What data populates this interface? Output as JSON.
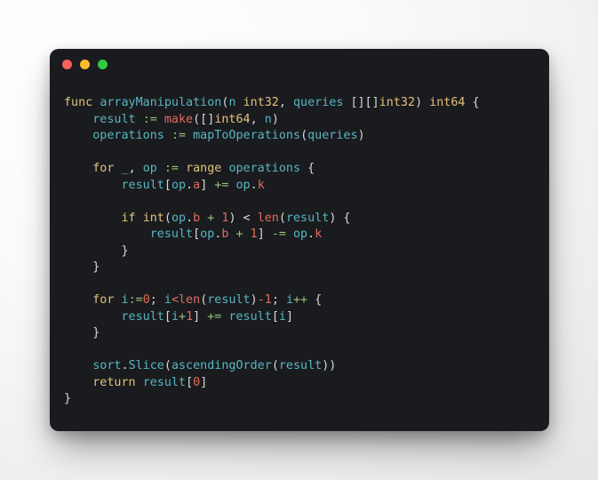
{
  "window": {
    "title": "",
    "traffic_lights": [
      {
        "name": "close",
        "color": "#f9615b"
      },
      {
        "name": "minimize",
        "color": "#fbbd2e"
      },
      {
        "name": "maximize",
        "color": "#2ecc41"
      }
    ]
  },
  "editor": {
    "language": "go",
    "background": "#1a1b1e",
    "foreground": "#d6d8da",
    "palette": {
      "keyword": "#e0c479",
      "type": "#e5c07b",
      "variable": "#56b6c2",
      "builtin": "#e06c5f",
      "number": "#e06c5f",
      "field": "#e06c5f",
      "operator": "#98c379",
      "punctuation": "#d6d8da"
    },
    "code_plain": "func arrayManipulation(n int32, queries [][]int32) int64 {\n    result := make([]int64, n)\n    operations := mapToOperations(queries)\n\n    for _, op := range operations {\n        result[op.a] += op.k\n\n        if int(op.b + 1) < len(result) {\n            result[op.b + 1] -= op.k\n        }\n    }\n\n    for i:=0; i<len(result)-1; i++ {\n        result[i+1] += result[i]\n    }\n\n    sort.Slice(ascendingOrder(result))\n    return result[0]\n}",
    "lines": [
      {
        "n": 1,
        "tokens": [
          {
            "t": "func",
            "c": "kw"
          },
          {
            "t": " ",
            "c": "pun"
          },
          {
            "t": "arrayManipulation",
            "c": "fn"
          },
          {
            "t": "(",
            "c": "pun"
          },
          {
            "t": "n",
            "c": "var"
          },
          {
            "t": " ",
            "c": "pun"
          },
          {
            "t": "int32",
            "c": "typ"
          },
          {
            "t": ", ",
            "c": "pun"
          },
          {
            "t": "queries",
            "c": "var"
          },
          {
            "t": " ",
            "c": "pun"
          },
          {
            "t": "[][]",
            "c": "pun"
          },
          {
            "t": "int32",
            "c": "typ"
          },
          {
            "t": ") ",
            "c": "pun"
          },
          {
            "t": "int64",
            "c": "typ"
          },
          {
            "t": " {",
            "c": "pun"
          }
        ]
      },
      {
        "n": 2,
        "tokens": [
          {
            "t": "    ",
            "c": "pun"
          },
          {
            "t": "result",
            "c": "var"
          },
          {
            "t": " ",
            "c": "pun"
          },
          {
            "t": ":=",
            "c": "op"
          },
          {
            "t": " ",
            "c": "pun"
          },
          {
            "t": "make",
            "c": "bi"
          },
          {
            "t": "([]",
            "c": "pun"
          },
          {
            "t": "int64",
            "c": "typ"
          },
          {
            "t": ", ",
            "c": "pun"
          },
          {
            "t": "n",
            "c": "var"
          },
          {
            "t": ")",
            "c": "pun"
          }
        ]
      },
      {
        "n": 3,
        "tokens": [
          {
            "t": "    ",
            "c": "pun"
          },
          {
            "t": "operations",
            "c": "var"
          },
          {
            "t": " ",
            "c": "pun"
          },
          {
            "t": ":=",
            "c": "op"
          },
          {
            "t": " ",
            "c": "pun"
          },
          {
            "t": "mapToOperations",
            "c": "fn"
          },
          {
            "t": "(",
            "c": "pun"
          },
          {
            "t": "queries",
            "c": "var"
          },
          {
            "t": ")",
            "c": "pun"
          }
        ]
      },
      {
        "n": 4,
        "tokens": []
      },
      {
        "n": 5,
        "tokens": [
          {
            "t": "    ",
            "c": "pun"
          },
          {
            "t": "for",
            "c": "kw"
          },
          {
            "t": " ",
            "c": "pun"
          },
          {
            "t": "_",
            "c": "var"
          },
          {
            "t": ", ",
            "c": "pun"
          },
          {
            "t": "op",
            "c": "var"
          },
          {
            "t": " ",
            "c": "pun"
          },
          {
            "t": ":=",
            "c": "op"
          },
          {
            "t": " ",
            "c": "pun"
          },
          {
            "t": "range",
            "c": "kw"
          },
          {
            "t": " ",
            "c": "pun"
          },
          {
            "t": "operations",
            "c": "var"
          },
          {
            "t": " {",
            "c": "pun"
          }
        ]
      },
      {
        "n": 6,
        "tokens": [
          {
            "t": "        ",
            "c": "pun"
          },
          {
            "t": "result",
            "c": "var"
          },
          {
            "t": "[",
            "c": "pun"
          },
          {
            "t": "op",
            "c": "var"
          },
          {
            "t": ".",
            "c": "pun"
          },
          {
            "t": "a",
            "c": "fld"
          },
          {
            "t": "] ",
            "c": "pun"
          },
          {
            "t": "+=",
            "c": "op"
          },
          {
            "t": " ",
            "c": "pun"
          },
          {
            "t": "op",
            "c": "var"
          },
          {
            "t": ".",
            "c": "pun"
          },
          {
            "t": "k",
            "c": "fld"
          }
        ]
      },
      {
        "n": 7,
        "tokens": []
      },
      {
        "n": 8,
        "tokens": [
          {
            "t": "        ",
            "c": "pun"
          },
          {
            "t": "if",
            "c": "kw"
          },
          {
            "t": " ",
            "c": "pun"
          },
          {
            "t": "int",
            "c": "typ"
          },
          {
            "t": "(",
            "c": "pun"
          },
          {
            "t": "op",
            "c": "var"
          },
          {
            "t": ".",
            "c": "pun"
          },
          {
            "t": "b",
            "c": "fld"
          },
          {
            "t": " ",
            "c": "pun"
          },
          {
            "t": "+",
            "c": "op"
          },
          {
            "t": " ",
            "c": "pun"
          },
          {
            "t": "1",
            "c": "num"
          },
          {
            "t": ") < ",
            "c": "pun"
          },
          {
            "t": "len",
            "c": "bi"
          },
          {
            "t": "(",
            "c": "pun"
          },
          {
            "t": "result",
            "c": "var"
          },
          {
            "t": ") {",
            "c": "pun"
          }
        ]
      },
      {
        "n": 9,
        "tokens": [
          {
            "t": "            ",
            "c": "pun"
          },
          {
            "t": "result",
            "c": "var"
          },
          {
            "t": "[",
            "c": "pun"
          },
          {
            "t": "op",
            "c": "var"
          },
          {
            "t": ".",
            "c": "pun"
          },
          {
            "t": "b",
            "c": "fld"
          },
          {
            "t": " ",
            "c": "pun"
          },
          {
            "t": "+",
            "c": "op"
          },
          {
            "t": " ",
            "c": "pun"
          },
          {
            "t": "1",
            "c": "num"
          },
          {
            "t": "] ",
            "c": "pun"
          },
          {
            "t": "-=",
            "c": "op"
          },
          {
            "t": " ",
            "c": "pun"
          },
          {
            "t": "op",
            "c": "var"
          },
          {
            "t": ".",
            "c": "pun"
          },
          {
            "t": "k",
            "c": "fld"
          }
        ]
      },
      {
        "n": 10,
        "tokens": [
          {
            "t": "        }",
            "c": "pun"
          }
        ]
      },
      {
        "n": 11,
        "tokens": [
          {
            "t": "    }",
            "c": "pun"
          }
        ]
      },
      {
        "n": 12,
        "tokens": []
      },
      {
        "n": 13,
        "tokens": [
          {
            "t": "    ",
            "c": "pun"
          },
          {
            "t": "for",
            "c": "kw"
          },
          {
            "t": " ",
            "c": "pun"
          },
          {
            "t": "i",
            "c": "var"
          },
          {
            "t": ":=",
            "c": "op"
          },
          {
            "t": "0",
            "c": "num"
          },
          {
            "t": "; ",
            "c": "pun"
          },
          {
            "t": "i",
            "c": "var"
          },
          {
            "t": "<",
            "c": "num"
          },
          {
            "t": "len",
            "c": "bi"
          },
          {
            "t": "(",
            "c": "pun"
          },
          {
            "t": "result",
            "c": "var"
          },
          {
            "t": ")",
            "c": "pun"
          },
          {
            "t": "-1",
            "c": "num"
          },
          {
            "t": "; ",
            "c": "pun"
          },
          {
            "t": "i",
            "c": "var"
          },
          {
            "t": "++",
            "c": "op"
          },
          {
            "t": " {",
            "c": "pun"
          }
        ]
      },
      {
        "n": 14,
        "tokens": [
          {
            "t": "        ",
            "c": "pun"
          },
          {
            "t": "result",
            "c": "var"
          },
          {
            "t": "[",
            "c": "pun"
          },
          {
            "t": "i",
            "c": "var"
          },
          {
            "t": "+",
            "c": "op"
          },
          {
            "t": "1",
            "c": "num"
          },
          {
            "t": "] ",
            "c": "pun"
          },
          {
            "t": "+=",
            "c": "op"
          },
          {
            "t": " ",
            "c": "pun"
          },
          {
            "t": "result",
            "c": "var"
          },
          {
            "t": "[",
            "c": "pun"
          },
          {
            "t": "i",
            "c": "var"
          },
          {
            "t": "]",
            "c": "pun"
          }
        ]
      },
      {
        "n": 15,
        "tokens": [
          {
            "t": "    }",
            "c": "pun"
          }
        ]
      },
      {
        "n": 16,
        "tokens": []
      },
      {
        "n": 17,
        "tokens": [
          {
            "t": "    ",
            "c": "pun"
          },
          {
            "t": "sort",
            "c": "var"
          },
          {
            "t": ".",
            "c": "pun"
          },
          {
            "t": "Slice",
            "c": "fn"
          },
          {
            "t": "(",
            "c": "pun"
          },
          {
            "t": "ascendingOrder",
            "c": "fn"
          },
          {
            "t": "(",
            "c": "pun"
          },
          {
            "t": "result",
            "c": "var"
          },
          {
            "t": "))",
            "c": "pun"
          }
        ]
      },
      {
        "n": 18,
        "tokens": [
          {
            "t": "    ",
            "c": "pun"
          },
          {
            "t": "return",
            "c": "kw"
          },
          {
            "t": " ",
            "c": "pun"
          },
          {
            "t": "result",
            "c": "var"
          },
          {
            "t": "[",
            "c": "pun"
          },
          {
            "t": "0",
            "c": "num"
          },
          {
            "t": "]",
            "c": "pun"
          }
        ]
      },
      {
        "n": 19,
        "tokens": [
          {
            "t": "}",
            "c": "pun"
          }
        ]
      }
    ]
  }
}
